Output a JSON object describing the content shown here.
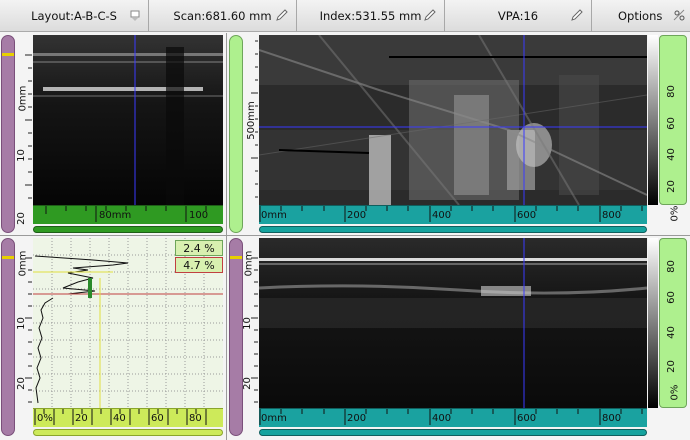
{
  "toolbar": {
    "layout": "Layout:A-B-C-S",
    "scan": "Scan:681.60 mm",
    "index": "Index:531.55 mm",
    "vpa": "VPA:16",
    "options": "Options"
  },
  "ascan_depth_ruler": {
    "labels": [
      "0mm",
      "10",
      "20"
    ]
  },
  "bscan_depth_ruler": {
    "labels": [
      "0mm",
      "10",
      "20"
    ]
  },
  "cscan_index_ruler": {
    "labels": [
      "500mm"
    ]
  },
  "sscan_index_ruler": {
    "labels": [
      "80mm",
      "100"
    ]
  },
  "cscan_scan_ruler": {
    "labels": [
      "0mm",
      "200",
      "400",
      "600",
      "800"
    ]
  },
  "bscan_scan_ruler": {
    "labels": [
      "0mm",
      "200",
      "400",
      "600",
      "800"
    ]
  },
  "ascan_amp_ruler": {
    "labels": [
      "0%",
      "20",
      "40",
      "60",
      "80"
    ]
  },
  "cscan_palette": {
    "labels": [
      "0%",
      "20",
      "40",
      "60",
      "80"
    ]
  },
  "bscan_palette": {
    "labels": [
      "0%",
      "20",
      "40",
      "60",
      "80"
    ]
  },
  "gates": {
    "gate_a_amp": "2.4 %",
    "gate_b_amp": "4.7 %"
  },
  "colors": {
    "cursor": "#3a3aff",
    "gate_a": "#e0e040",
    "gate_b": "#c04040",
    "ruler_purple": "#a67ca6",
    "ruler_green": "#aef08e"
  }
}
